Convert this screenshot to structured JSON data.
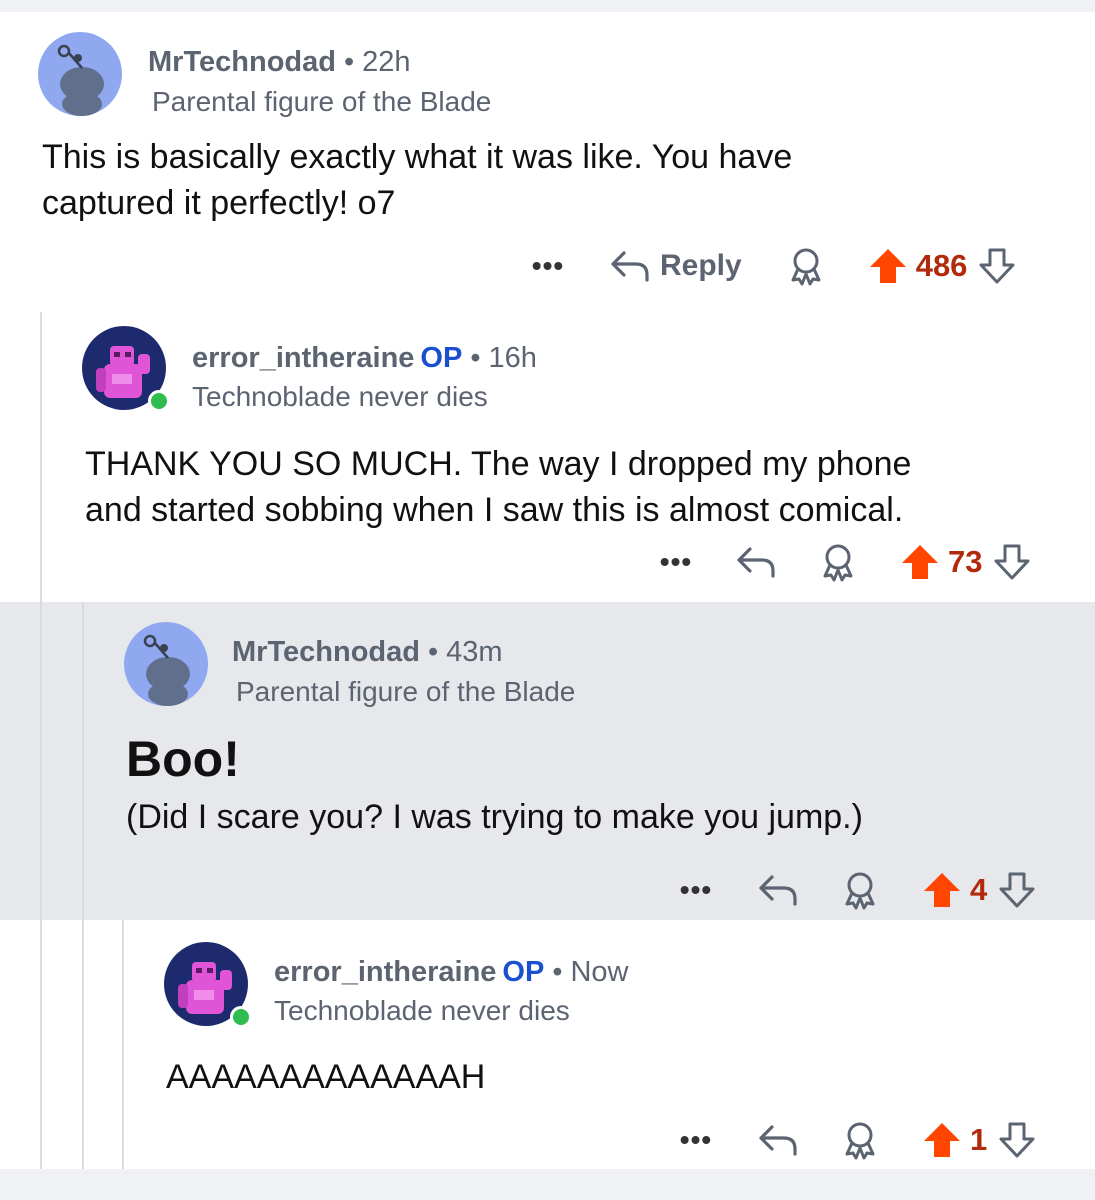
{
  "comments": [
    {
      "username": "MrTechnodad",
      "op": "",
      "time": "22h",
      "flair": "Parental figure of the Blade",
      "body": [
        "This is basically exactly what it was like. You have",
        "captured it perfectly! o7"
      ],
      "reply_label": "Reply",
      "score": "486",
      "avatar": "snoo-avatar-icon"
    },
    {
      "username": "error_intheraine",
      "op": "OP",
      "time": "16h",
      "flair": "Technoblade never dies",
      "body": [
        "THANK YOU SO MUCH. The way I dropped my phone",
        "and started sobbing when I saw this is almost comical."
      ],
      "score": "73",
      "avatar": "pink-robot-avatar-icon",
      "online": true
    },
    {
      "username": "MrTechnodad",
      "op": "",
      "time": "43m",
      "flair": "Parental figure of the Blade",
      "heading": "Boo!",
      "body": [
        "(Did I scare you? I was trying to make you jump.)"
      ],
      "score": "4",
      "avatar": "snoo-avatar-icon",
      "highlighted": true
    },
    {
      "username": "error_intheraine",
      "op": "OP",
      "time": "Now",
      "flair": "Technoblade never dies",
      "body": [
        "AAAAAAAAAAAAAH"
      ],
      "score": "1",
      "avatar": "pink-robot-avatar-icon",
      "online": true
    }
  ],
  "actions": {
    "more": "•••"
  },
  "colors": {
    "upvote": "#ff4500",
    "score": "#b12a0c",
    "op_tag": "#1a4fd0",
    "meta": "#5b6470",
    "highlight_bg": "#e6e8ec",
    "online": "#2ebd4e"
  }
}
